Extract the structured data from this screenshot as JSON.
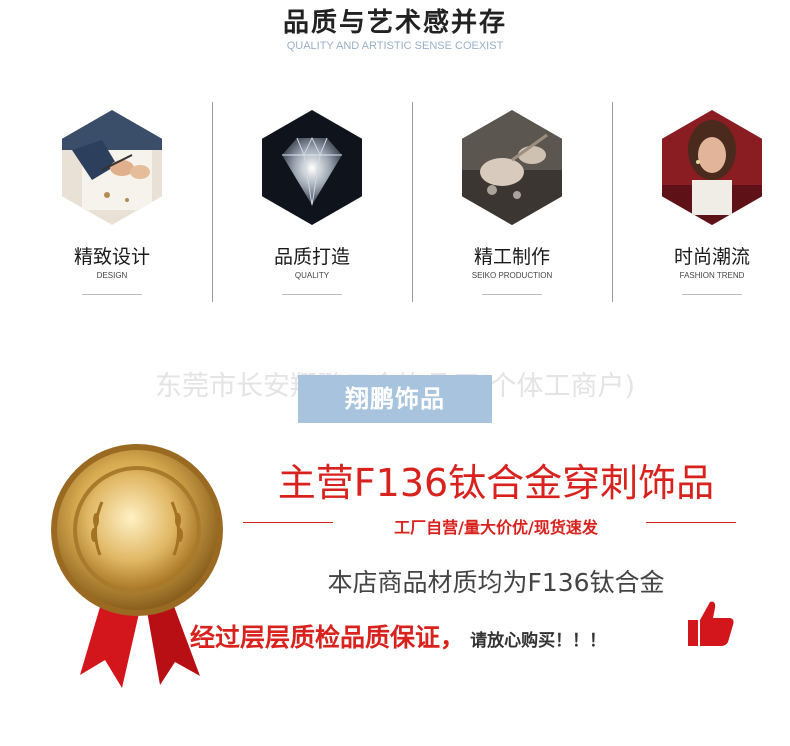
{
  "header": {
    "title": "品质与艺术感并存",
    "subtitle": "QUALITY AND ARTISTIC SENSE COEXIST"
  },
  "features": [
    {
      "label": "精致设计",
      "sub": "DESIGN",
      "icon": "sketch-photo"
    },
    {
      "label": "品质打造",
      "sub": "QUALITY",
      "icon": "diamond-photo"
    },
    {
      "label": "精工制作",
      "sub": "SEIKO PRODUCTION",
      "icon": "craftsman-photo"
    },
    {
      "label": "时尚潮流",
      "sub": "FASHION TREND",
      "icon": "model-photo"
    }
  ],
  "company": {
    "watermark": "东莞市长安翔鹏五金饰品厂(个体工商户)",
    "brand": "翔鹏饰品"
  },
  "promo": {
    "main_title": "主营F136钛合金穿刺饰品",
    "tagline": "工厂自营/量大价优/现货速发",
    "material": "本店商品材质均为F136钛合金",
    "quality": "经过层层质检品质保证，",
    "reassure": "请放心购买！！！"
  },
  "colors": {
    "accent_red": "#d9211d",
    "brand_blue": "#a7c3de",
    "subtitle_blue": "#9ab0c8",
    "medal_gold": "#c99a3a"
  }
}
